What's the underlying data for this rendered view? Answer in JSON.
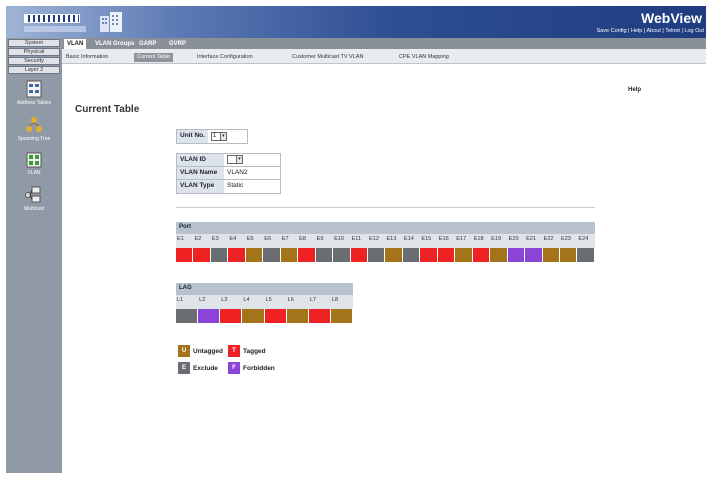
{
  "header": {
    "brand": "WebView",
    "links": "Save Config | Help | About | Telnet | Log Out"
  },
  "leftnav": {
    "buttons": [
      "System",
      "Physical",
      "Security",
      "Layer 2"
    ],
    "icons": [
      {
        "label": "Address Tables",
        "icon": "address-tables-icon"
      },
      {
        "label": "Spanning Tree",
        "icon": "spanning-tree-icon"
      },
      {
        "label": "VLAN",
        "icon": "vlan-icon"
      },
      {
        "label": "Multicast",
        "icon": "multicast-icon"
      }
    ]
  },
  "tabs": {
    "primary": [
      "VLAN",
      "VLAN Groups",
      "GARP",
      "GVRP"
    ],
    "secondary": [
      "Basic Information",
      "Current Table",
      "Interface Configuration",
      "Customer Multicast TV VLAN",
      "CPE VLAN Mapping"
    ]
  },
  "page": {
    "title": "Current Table",
    "help": "Help"
  },
  "form": {
    "unit_label": "Unit No.",
    "unit_value": "1",
    "vlan_id_label": "VLAN ID",
    "vlan_id_value": "",
    "vlan_name_label": "VLAN Name",
    "vlan_name_value": "VLAN2",
    "vlan_type_label": "VLAN Type",
    "vlan_type_value": "Static"
  },
  "ports": {
    "title": "Port",
    "labels": [
      "E1",
      "E2",
      "E3",
      "E4",
      "E5",
      "E6",
      "E7",
      "E8",
      "E9",
      "E10",
      "E11",
      "E12",
      "E13",
      "E14",
      "E15",
      "E16",
      "E17",
      "E18",
      "E19",
      "E20",
      "E21",
      "E22",
      "E23",
      "E24"
    ],
    "states": [
      "T",
      "T",
      "E",
      "T",
      "U",
      "E",
      "U",
      "T",
      "E",
      "E",
      "T",
      "E",
      "U",
      "E",
      "T",
      "T",
      "U",
      "T",
      "U",
      "F",
      "F",
      "U",
      "U",
      "E"
    ]
  },
  "lag": {
    "title": "LAG",
    "labels": [
      "L1",
      "L2",
      "L3",
      "L4",
      "L5",
      "L6",
      "L7",
      "L8"
    ],
    "states": [
      "E",
      "F",
      "T",
      "U",
      "T",
      "U",
      "T",
      "U"
    ]
  },
  "legend": {
    "untagged": {
      "code": "U",
      "label": "Untagged",
      "color": "#a4741a"
    },
    "tagged": {
      "code": "T",
      "label": "Tagged",
      "color": "#ee2222"
    },
    "exclude": {
      "code": "E",
      "label": "Exclude",
      "color": "#6a6e73"
    },
    "forbidden": {
      "code": "F",
      "label": "Forbidden",
      "color": "#8a44d8"
    }
  }
}
